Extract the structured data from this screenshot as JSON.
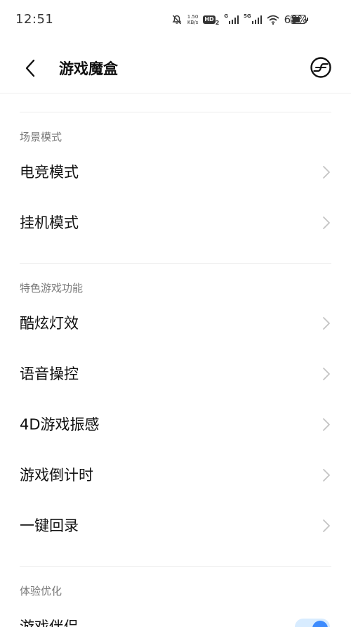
{
  "status_bar": {
    "time": "12:51",
    "net_speed_value": "1.50",
    "net_speed_unit": "KB/s",
    "hd_label": "HD",
    "signal1_label": "G",
    "signal2_label": "5G",
    "battery_percent": "68%",
    "battery_level": 0.68
  },
  "header": {
    "title": "游戏魔盒"
  },
  "sections": [
    {
      "title": "场景模式",
      "items": [
        {
          "label": "电竞模式"
        },
        {
          "label": "挂机模式"
        }
      ]
    },
    {
      "title": "特色游戏功能",
      "items": [
        {
          "label": "酷炫灯效"
        },
        {
          "label": "语音操控"
        },
        {
          "label": "4D游戏振感"
        },
        {
          "label": "游戏倒计时"
        },
        {
          "label": "一键回录"
        }
      ]
    },
    {
      "title": "体验优化",
      "items": [
        {
          "label": "游戏伴侣"
        }
      ]
    }
  ],
  "icons": {
    "back": "chevron-left-icon",
    "header_action": "game-mode-icon",
    "row_arrow": "chevron-right-icon"
  },
  "colors": {
    "text_primary": "#111111",
    "section_title": "#7a7a7a",
    "divider": "#ececec",
    "chevron": "#c4c4c4",
    "toggle_accent": "#3d8bfd"
  }
}
